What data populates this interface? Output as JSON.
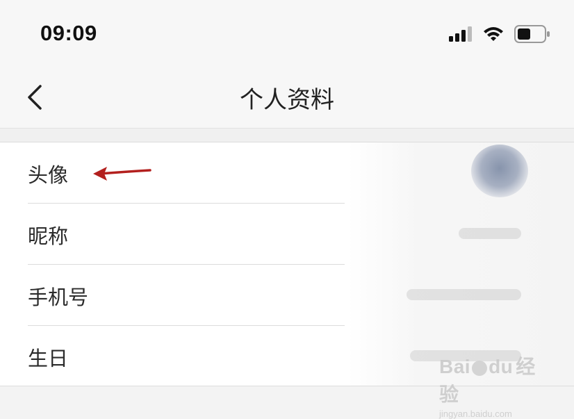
{
  "status_bar": {
    "time": "09:09"
  },
  "nav": {
    "title": "个人资料"
  },
  "rows": [
    {
      "label": "头像"
    },
    {
      "label": "昵称"
    },
    {
      "label": "手机号"
    },
    {
      "label": "生日"
    }
  ],
  "annotation": {
    "arrow_color": "#b3201e"
  },
  "watermark": {
    "brand": "Bai",
    "brand2": "du",
    "suffix": "经验",
    "url": "jingyan.baidu.com"
  }
}
